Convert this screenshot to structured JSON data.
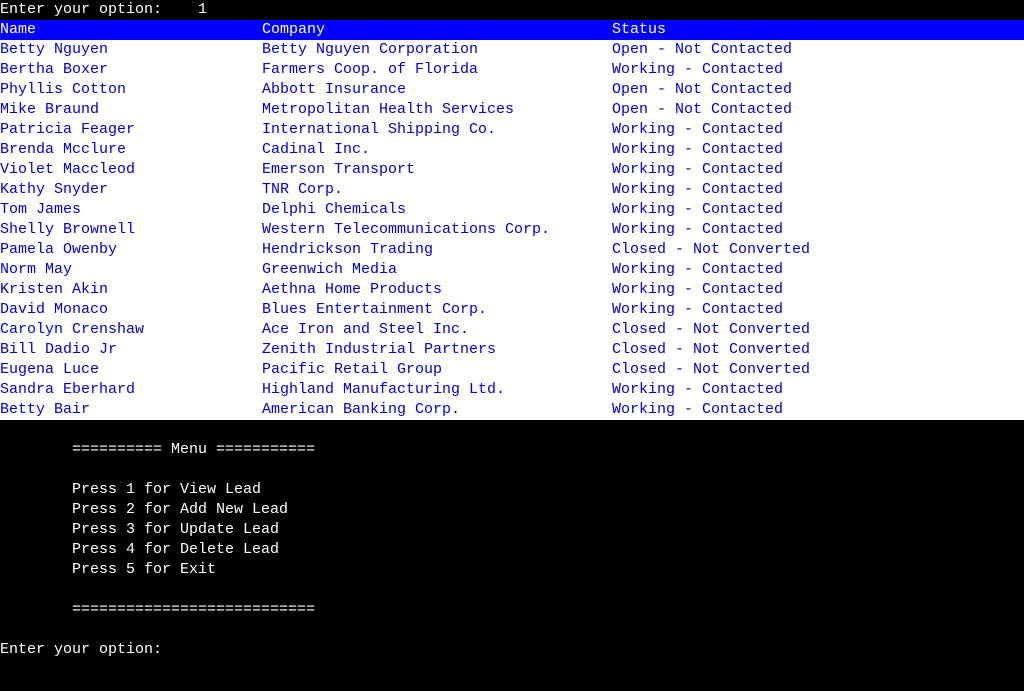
{
  "prompt_top": {
    "label": "Enter your option:",
    "value": "1"
  },
  "table": {
    "headers": {
      "name": "Name",
      "company": "Company",
      "status": "Status"
    },
    "rows": [
      {
        "name": "Betty Nguyen",
        "company": "Betty Nguyen Corporation",
        "status": "Open - Not Contacted"
      },
      {
        "name": "Bertha Boxer",
        "company": "Farmers Coop. of Florida",
        "status": "Working - Contacted"
      },
      {
        "name": "Phyllis Cotton",
        "company": "Abbott Insurance",
        "status": "Open - Not Contacted"
      },
      {
        "name": "Mike Braund",
        "company": "Metropolitan Health Services",
        "status": "Open - Not Contacted"
      },
      {
        "name": "Patricia Feager",
        "company": "International Shipping Co.",
        "status": "Working - Contacted"
      },
      {
        "name": "Brenda Mcclure",
        "company": "Cadinal Inc.",
        "status": "Working - Contacted"
      },
      {
        "name": "Violet Maccleod",
        "company": "Emerson Transport",
        "status": "Working - Contacted"
      },
      {
        "name": "Kathy Snyder",
        "company": "TNR Corp.",
        "status": "Working - Contacted"
      },
      {
        "name": "Tom James",
        "company": "Delphi Chemicals",
        "status": "Working - Contacted"
      },
      {
        "name": "Shelly Brownell",
        "company": "Western Telecommunications Corp.",
        "status": "Working - Contacted"
      },
      {
        "name": "Pamela Owenby",
        "company": "Hendrickson Trading",
        "status": "Closed - Not Converted"
      },
      {
        "name": "Norm May",
        "company": "Greenwich Media",
        "status": "Working - Contacted"
      },
      {
        "name": "Kristen Akin",
        "company": "Aethna Home Products",
        "status": "Working - Contacted"
      },
      {
        "name": "David Monaco",
        "company": "Blues Entertainment Corp.",
        "status": "Working - Contacted"
      },
      {
        "name": "Carolyn Crenshaw",
        "company": "Ace Iron and Steel Inc.",
        "status": "Closed - Not Converted"
      },
      {
        "name": "Bill Dadio Jr",
        "company": "Zenith Industrial Partners",
        "status": "Closed - Not Converted"
      },
      {
        "name": "Eugena Luce",
        "company": "Pacific Retail Group",
        "status": "Closed - Not Converted"
      },
      {
        "name": "Sandra Eberhard",
        "company": "Highland Manufacturing Ltd.",
        "status": "Working - Contacted"
      },
      {
        "name": "Betty Bair",
        "company": "American Banking Corp.",
        "status": "Working - Contacted"
      }
    ]
  },
  "menu": {
    "title": "========== Menu ===========",
    "items": [
      "Press 1 for View Lead",
      "Press 2 for Add New Lead",
      "Press 3 for Update Lead",
      "Press 4 for Delete Lead",
      "Press 5 for Exit"
    ],
    "footer": "==========================="
  },
  "prompt_bottom": {
    "label": "Enter your option:"
  }
}
